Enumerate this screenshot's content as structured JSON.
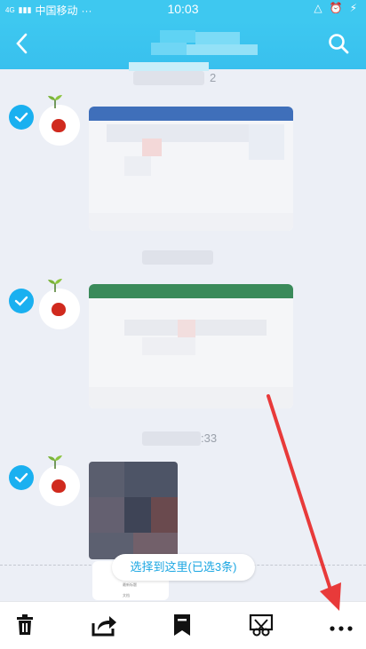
{
  "status_bar": {
    "network": "4G",
    "carrier": "中国移动",
    "dots": "···",
    "time": "10:03"
  },
  "nav": {
    "title_tail": "2"
  },
  "messages": [
    {
      "timestamp_tail": ""
    },
    {
      "timestamp_tail": ""
    },
    {
      "timestamp_tail": ":33"
    }
  ],
  "footer_hint": {
    "text": "选择到这里(已选3条)"
  },
  "preview": {
    "line1": "最新标题",
    "line2": "文档"
  },
  "toolbar": {
    "items": [
      "delete-icon",
      "share-icon",
      "bookmark-icon",
      "scissors-icon",
      "more-icon"
    ]
  },
  "colors": {
    "accent": "#3ec8f0",
    "check": "#1ab0f0",
    "arrow": "#e83a3a"
  }
}
